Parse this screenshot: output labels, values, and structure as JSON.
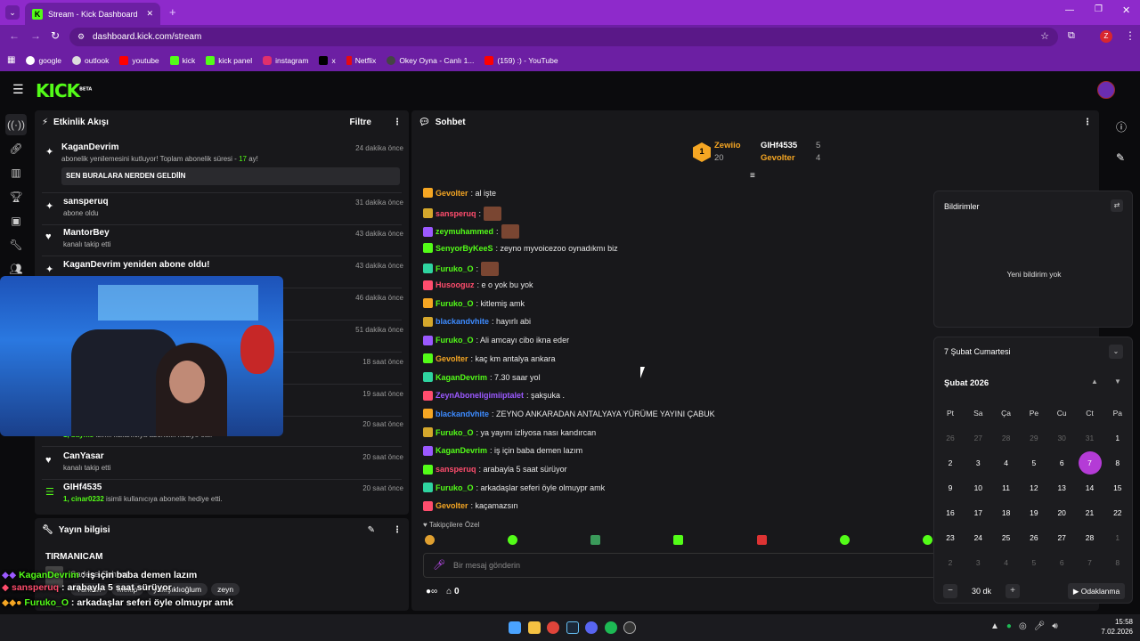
{
  "browser": {
    "tab_title": "Stream - Kick Dashboard",
    "url": "dashboard.kick.com/stream",
    "profile_initial": "Z",
    "bookmarks": [
      "google",
      "outlook",
      "youtube",
      "kick",
      "kick panel",
      "instagram",
      "x",
      "Netflix",
      "Okey Oyna - Canlı 1...",
      "(159) :) - YouTube"
    ]
  },
  "kick": {
    "logo": "KICK",
    "beta": "BETA"
  },
  "activity": {
    "title": "Etkinlik Akışı",
    "filter": "Filtre",
    "events": [
      {
        "name": "KaganDevrim",
        "sub": "abonelik yenilemesini kutluyor! Toplam abonelik süresi - ",
        "sub_hl": "17",
        "sub_end": " ay!",
        "time": "24 dakika önce",
        "msg": "SEN BURALARA NERDEN GELDİİN"
      },
      {
        "name": "sansperuq",
        "sub": "abone oldu",
        "time": "31 dakika önce"
      },
      {
        "name": "MantorBey",
        "sub": "kanalı takip etti",
        "time": "43 dakika önce"
      },
      {
        "name": "KaganDevrim yeniden abone oldu!",
        "sub": "",
        "time": "43 dakika önce"
      },
      {
        "time": "46 dakika önce"
      },
      {
        "time": "51 dakika önce"
      },
      {
        "time": "18 saat önce"
      },
      {
        "time": "19 saat önce"
      },
      {
        "sub_hl": "1, baynis",
        "sub": " isimli kullanıcıya abonelik hediye etti.",
        "time": "20 saat önce"
      },
      {
        "name": "CanYasar",
        "sub": "kanalı takip etti",
        "time": "20 saat önce"
      },
      {
        "name": "GIHf4535",
        "sub_hl": "1, cinar0232",
        "sub": " isimli kullanıcıya abonelik hediye etti.",
        "time": "20 saat önce"
      }
    ]
  },
  "stream_info": {
    "title": "Yayın bilgisi",
    "stream_title": "TIRMANICAM",
    "category": "Sadece Sohbet",
    "tags": [
      "Turkish",
      "Mekip",
      "yakışıklıoğlum",
      "zeyn"
    ]
  },
  "overlay_chat": [
    {
      "user": "KaganDevrim",
      "text": " : iş için baba demen lazım",
      "color": "#53fc18"
    },
    {
      "user": "sansperuq",
      "text": " : arabayla 5 saat sürüyor",
      "color": "#ff4d6d"
    },
    {
      "user": "Furuko_O",
      "text": " : arkadaşlar seferi öyle olmuypr amk",
      "color": "#53fc18"
    }
  ],
  "chat": {
    "title": "Sohbet",
    "leaderboard": [
      {
        "name": "Zewiio",
        "count": "20",
        "rank": "1"
      },
      {
        "name": "GIHf4535",
        "count": "5"
      },
      {
        "name": "Gevolter",
        "count": "4"
      }
    ],
    "messages": [
      {
        "user": "Gevolter",
        "text": ": al işte",
        "color": "#f5a623"
      },
      {
        "user": "sansperuq",
        "text": ":",
        "color": "#ff4d6d",
        "emote": true
      },
      {
        "user": "zeymuhammed",
        "text": ":",
        "color": "#53fc18",
        "emote": true
      },
      {
        "user": "SenyorByKeeS",
        "text": ": zeyno myvoicezoo oynadıkmı biz",
        "color": "#53fc18"
      },
      {
        "user": "Furuko_O",
        "text": ":",
        "color": "#53fc18",
        "emote": true
      },
      {
        "user": "Husooguz",
        "text": ": e o yok bu yok",
        "color": "#ff4d6d"
      },
      {
        "user": "Furuko_O",
        "text": ": kitlemiş amk",
        "color": "#53fc18"
      },
      {
        "user": "blackandvhite",
        "text": ": hayırlı abi",
        "color": "#3d8bff"
      },
      {
        "user": "Furuko_O",
        "text": ": Ali amcayı cibo ikna eder",
        "color": "#53fc18"
      },
      {
        "user": "Gevolter",
        "text": ": kaç km antalya ankara",
        "color": "#f5a623"
      },
      {
        "user": "KaganDevrim",
        "text": ": 7.30 saar yol",
        "color": "#53fc18"
      },
      {
        "user": "ZeynAboneligimiiptalet",
        "text": ": şakşuka .",
        "color": "#9b59ff"
      },
      {
        "user": "blackandvhite",
        "text": ": ZEYNO ANKARADAN ANTALYAYA YÜRÜME YAYINI ÇABUK",
        "color": "#3d8bff"
      },
      {
        "user": "Furuko_O",
        "text": ": ya yayını izliyosa nası kandırcan",
        "color": "#53fc18"
      },
      {
        "user": "KaganDevrim",
        "text": ": iş için baba demen lazım",
        "color": "#53fc18"
      },
      {
        "user": "sansperuq",
        "text": ": arabayla 5 saat sürüyor",
        "color": "#ff4d6d"
      },
      {
        "user": "Furuko_O",
        "text": ": arkadaşlar seferi öyle olmuypr amk",
        "color": "#53fc18"
      },
      {
        "user": "Gevolter",
        "text": ": kaçamazsın",
        "color": "#f5a623"
      }
    ],
    "emote_tab": "Takipçilere Özel",
    "input_placeholder": "Bir mesaj gönderin",
    "viewer_count": "0"
  },
  "notifications": {
    "title": "Bildirimler",
    "empty": "Yeni bildirim yok"
  },
  "calendar": {
    "date_header": "7 Şubat Cumartesi",
    "month": "Şubat 2026",
    "weekdays": [
      "Pt",
      "Sa",
      "Ça",
      "Pe",
      "Cu",
      "Ct",
      "Pa"
    ],
    "weeks": [
      [
        "26",
        "27",
        "28",
        "29",
        "30",
        "31",
        "1"
      ],
      [
        "2",
        "3",
        "4",
        "5",
        "6",
        "7",
        "8"
      ],
      [
        "9",
        "10",
        "11",
        "12",
        "13",
        "14",
        "15"
      ],
      [
        "16",
        "17",
        "18",
        "19",
        "20",
        "21",
        "22"
      ],
      [
        "23",
        "24",
        "25",
        "26",
        "27",
        "28",
        "1"
      ],
      [
        "2",
        "3",
        "4",
        "5",
        "6",
        "7",
        "8"
      ]
    ],
    "selected": "7",
    "focus_minutes": "30 dk",
    "focus_button": "Odaklanma"
  },
  "taskbar": {
    "time": "15:58",
    "date": "7.02.2026"
  }
}
